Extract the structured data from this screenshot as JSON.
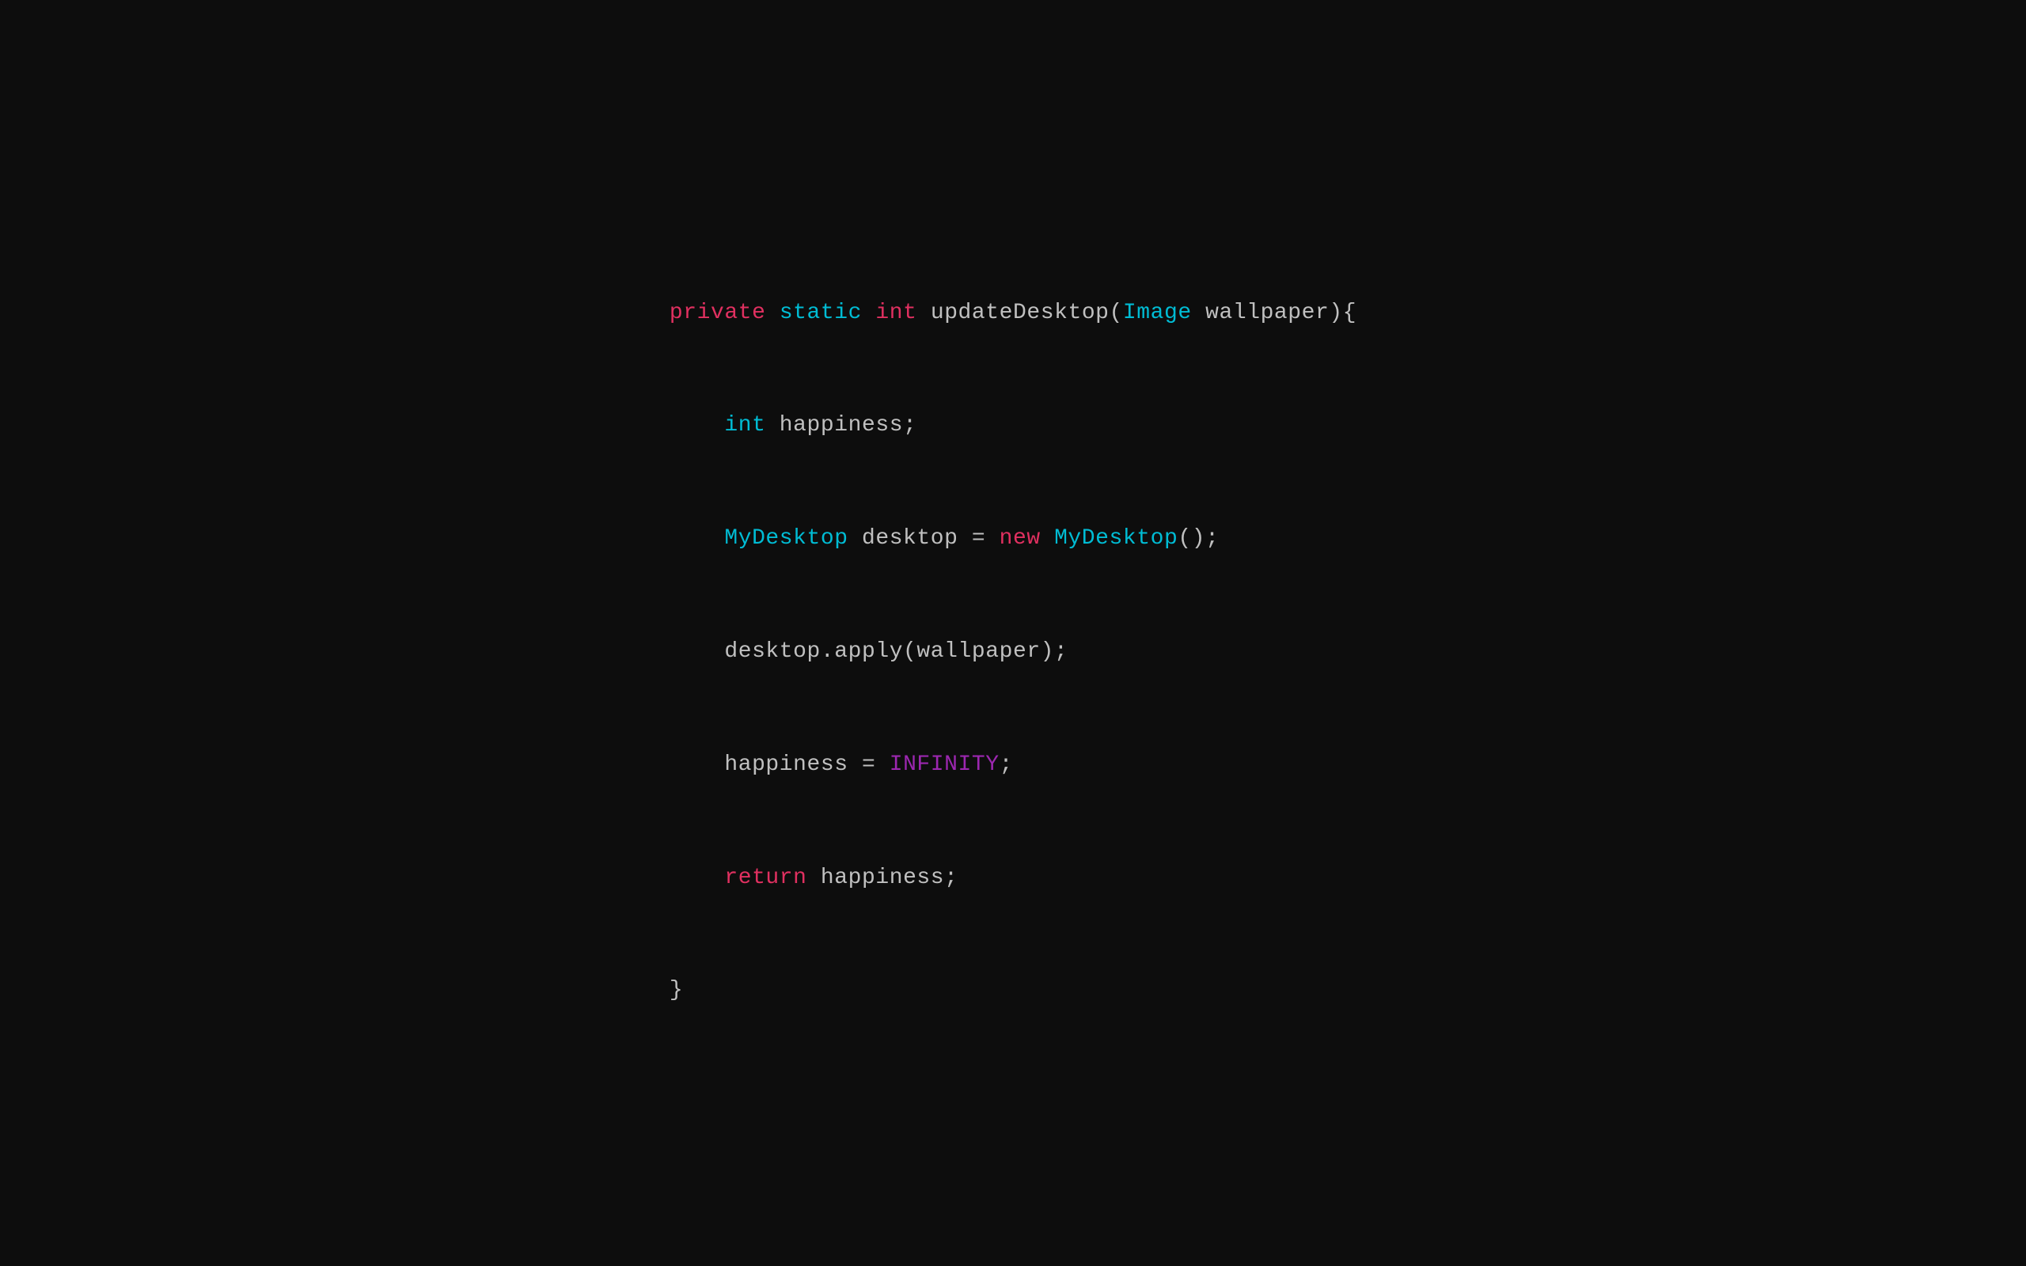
{
  "code": {
    "line1": {
      "private": "private",
      "static": "static",
      "int": "int",
      "rest": " updateDesktop(",
      "Image": "Image",
      "wallpaper": " wallpaper){"
    },
    "line2": {
      "int": "int",
      "rest": " happiness;"
    },
    "line3": {
      "MyDesktop": "MyDesktop",
      "rest1": " desktop = ",
      "new": "new",
      "MyDesktop2": " MyDesktop",
      "rest2": "();"
    },
    "line4": {
      "text": "desktop.apply(wallpaper);"
    },
    "line5": {
      "text1": "happiness = ",
      "infinity": "INFINITY",
      "text2": ";"
    },
    "line6": {
      "return": "return",
      "text": " happiness;"
    },
    "line7": {
      "text": "}"
    }
  }
}
